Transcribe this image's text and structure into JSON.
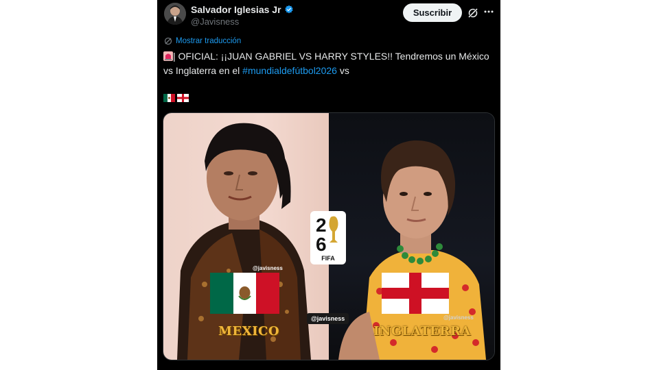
{
  "account": {
    "name": "Salvador Iglesias Jr",
    "handle": "@Javisness",
    "verified": true
  },
  "actions": {
    "subscribe_label": "Suscribir",
    "grok_icon": "grok-icon",
    "more_icon": "more-icon"
  },
  "tweet": {
    "translate_label": "Mostrar traducción",
    "text_part1": "| OFICIAL: ¡¡JUAN GABRIEL VS HARRY STYLES!! Tendremos un México vs Inglaterra en el ",
    "hashtag": "#mundialdefútbol2026",
    "text_part2": " vs",
    "emoji_flags": [
      "mexico-flag",
      "england-flag"
    ]
  },
  "media": {
    "left_country": "MEXICO",
    "right_country": "INGLATERRA",
    "watermark_center": "@javisness",
    "watermark_left": "@javisness",
    "watermark_right": "@javisness",
    "logo_text": "FIFA"
  },
  "colors": {
    "background": "#000000",
    "text": "#e7e9ea",
    "secondary": "#71767b",
    "link": "#1d9bf0",
    "verified": "#1d9bf0",
    "country_gold": "#f0b63a"
  }
}
